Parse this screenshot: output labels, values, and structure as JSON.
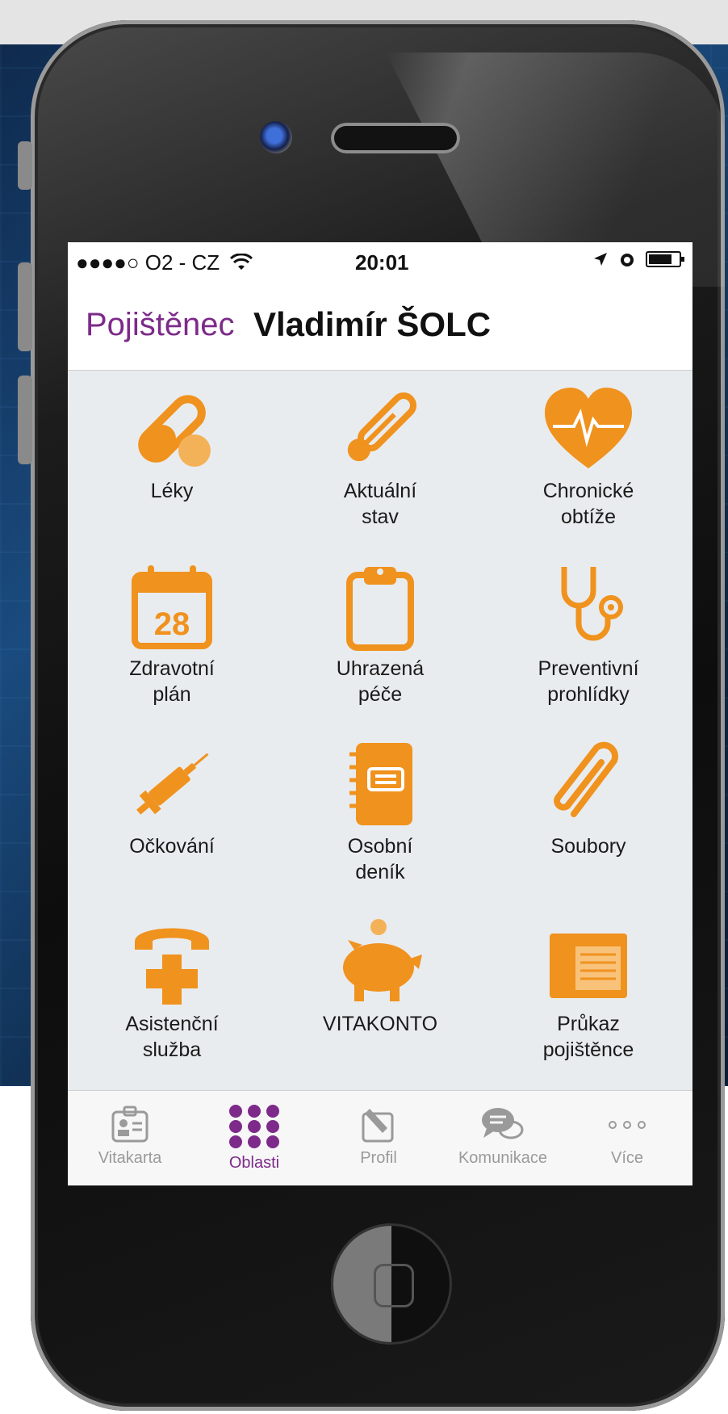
{
  "status_bar": {
    "carrier": "●●●●○ O2 - CZ",
    "time": "20:01"
  },
  "nav": {
    "back_label": "Pojištěnec",
    "title": "Vladimír ŠOLC"
  },
  "tiles": [
    {
      "label": "Léky",
      "icon": "pill-icon"
    },
    {
      "label": "Aktuální\nstav",
      "icon": "thermometer-icon"
    },
    {
      "label": "Chronické\nobtíže",
      "icon": "heart-pulse-icon"
    },
    {
      "label": "Zdravotní\nplán",
      "icon": "calendar-icon",
      "calendar_day": "28"
    },
    {
      "label": "Uhrazená\npéče",
      "icon": "clipboard-icon"
    },
    {
      "label": "Preventivní\nprohlídky",
      "icon": "stethoscope-icon"
    },
    {
      "label": "Očkování",
      "icon": "syringe-icon"
    },
    {
      "label": "Osobní\ndeník",
      "icon": "notebook-icon"
    },
    {
      "label": "Soubory",
      "icon": "paperclip-icon"
    },
    {
      "label": "Asistenční\nslužba",
      "icon": "phone-cross-icon"
    },
    {
      "label": "VITAKONTO",
      "icon": "piggy-bank-icon"
    },
    {
      "label": "Průkaz\npojištěnce",
      "icon": "id-card-icon"
    }
  ],
  "tab_bar": [
    {
      "label": "Vitakarta",
      "icon": "badge-icon",
      "active": false
    },
    {
      "label": "Oblasti",
      "icon": "grid-dots-icon",
      "active": true
    },
    {
      "label": "Profil",
      "icon": "edit-profile-icon",
      "active": false
    },
    {
      "label": "Komunikace",
      "icon": "chat-bubbles-icon",
      "active": false
    },
    {
      "label": "Více",
      "icon": "more-dots-icon",
      "active": false
    }
  ],
  "colors": {
    "accent_orange": "#f0921e",
    "accent_purple": "#7d2a8a",
    "screen_bg": "#e9ecee"
  }
}
